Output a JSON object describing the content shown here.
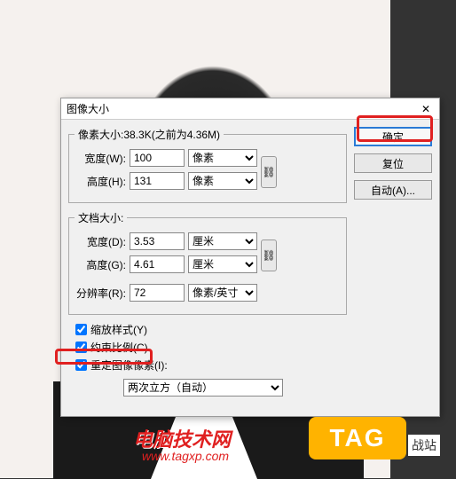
{
  "dialog": {
    "title": "图像大小",
    "pixel_dims": {
      "legend": "像素大小:38.3K(之前为4.36M)",
      "width_label": "宽度(W):",
      "width_value": "100",
      "height_label": "高度(H):",
      "height_value": "131",
      "unit": "像素"
    },
    "doc_size": {
      "legend": "文档大小:",
      "width_label": "宽度(D):",
      "width_value": "3.53",
      "height_label": "高度(G):",
      "height_value": "4.61",
      "unit": "厘米",
      "res_label": "分辨率(R):",
      "res_value": "72",
      "res_unit": "像素/英寸"
    },
    "checks": {
      "scale_styles": "缩放样式(Y)",
      "constrain": "约束比例(C)",
      "resample": "重定图像像素(I):"
    },
    "resample_method": "两次立方（自动）",
    "buttons": {
      "ok": "确定",
      "reset": "复位",
      "auto": "自动(A)..."
    },
    "link_glyph": "⛓"
  },
  "watermark": {
    "text": "电脑技术网",
    "url": "www.tagxp.com",
    "badge": "TAG",
    "suffix": "战站"
  }
}
